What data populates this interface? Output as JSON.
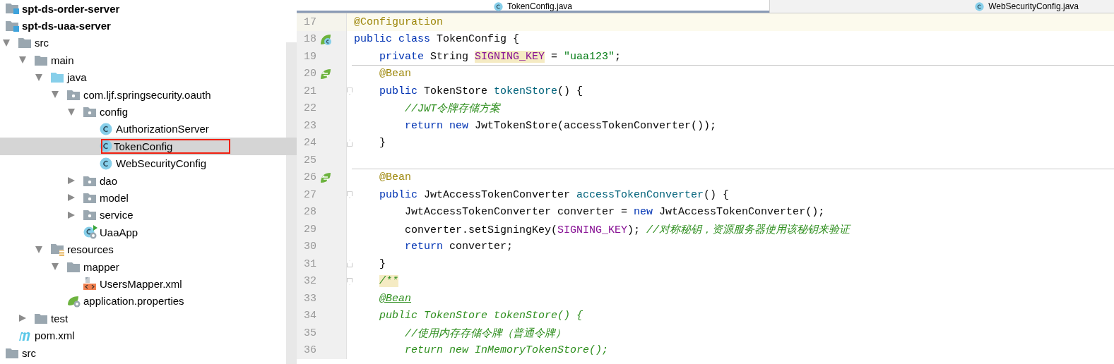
{
  "project_tree": [
    {
      "label": "spt-ds-order-server",
      "kind": "module"
    },
    {
      "label": "spt-ds-uaa-server",
      "kind": "module",
      "children": [
        {
          "label": "src",
          "kind": "folder",
          "expanded": true,
          "children": [
            {
              "label": "main",
              "kind": "folder",
              "expanded": true,
              "children": [
                {
                  "label": "java",
                  "kind": "source-folder",
                  "expanded": true,
                  "children": [
                    {
                      "label": "com.ljf.springsecurity.oauth",
                      "kind": "package",
                      "expanded": true,
                      "children": [
                        {
                          "label": "config",
                          "kind": "package",
                          "expanded": true,
                          "children": [
                            {
                              "label": "AuthorizationServer",
                              "kind": "class",
                              "selected": false,
                              "outlined": false
                            },
                            {
                              "label": "TokenConfig",
                              "kind": "class",
                              "selected": true,
                              "outlined": true
                            },
                            {
                              "label": "WebSecurityConfig",
                              "kind": "class",
                              "selected": false,
                              "outlined": false
                            }
                          ]
                        },
                        {
                          "label": "dao",
                          "kind": "package",
                          "expanded": false
                        },
                        {
                          "label": "model",
                          "kind": "package",
                          "expanded": false
                        },
                        {
                          "label": "service",
                          "kind": "package",
                          "expanded": false
                        },
                        {
                          "label": "UaaApp",
                          "kind": "app-class"
                        }
                      ]
                    }
                  ]
                },
                {
                  "label": "resources",
                  "kind": "resources-folder",
                  "expanded": true,
                  "children": [
                    {
                      "label": "mapper",
                      "kind": "folder",
                      "expanded": true,
                      "children": [
                        {
                          "label": "UsersMapper.xml",
                          "kind": "xml"
                        }
                      ]
                    },
                    {
                      "label": "application.properties",
                      "kind": "properties"
                    }
                  ]
                }
              ]
            },
            {
              "label": "test",
              "kind": "folder",
              "expanded": false
            }
          ]
        },
        {
          "label": "pom.xml",
          "kind": "pom"
        }
      ]
    },
    {
      "label": "src",
      "kind": "folder"
    }
  ],
  "editor": {
    "tabs": [
      {
        "label": "TokenConfig.java",
        "selected": true
      },
      {
        "label": "WebSecurityConfig.java",
        "selected": false
      }
    ],
    "lines": [
      {
        "number": "17",
        "current": true,
        "tokens": [
          {
            "text": "@Configuration",
            "kind": "annotation"
          }
        ]
      },
      {
        "number": "18",
        "class_bean_marker": true,
        "tokens": [
          {
            "text": "public class ",
            "kind": "keyword"
          },
          {
            "text": "TokenConfig {",
            "kind": "plain"
          }
        ]
      },
      {
        "number": "19",
        "separator_after": true,
        "tokens": [
          {
            "text": "    private ",
            "kind": "keyword"
          },
          {
            "text": "String ",
            "kind": "plain"
          },
          {
            "text": "SIGNING_KEY",
            "kind": "field",
            "highlighted": true
          },
          {
            "text": " = ",
            "kind": "plain"
          },
          {
            "text": "\"uaa123\"",
            "kind": "string"
          },
          {
            "text": ";",
            "kind": "plain"
          }
        ]
      },
      {
        "number": "20",
        "bean_marker": true,
        "tokens": [
          {
            "text": "    @Bean",
            "kind": "annotation"
          }
        ]
      },
      {
        "number": "21",
        "fold_start": true,
        "tokens": [
          {
            "text": "    public ",
            "kind": "keyword"
          },
          {
            "text": "TokenStore ",
            "kind": "plain"
          },
          {
            "text": "tokenStore",
            "kind": "method"
          },
          {
            "text": "() {",
            "kind": "plain"
          }
        ]
      },
      {
        "number": "22",
        "tokens": [
          {
            "text": "        //JWT令牌存储方案",
            "kind": "comment"
          }
        ]
      },
      {
        "number": "23",
        "tokens": [
          {
            "text": "        return new ",
            "kind": "keyword"
          },
          {
            "text": "JwtTokenStore(accessTokenConverter());",
            "kind": "plain"
          }
        ]
      },
      {
        "number": "24",
        "fold_end": true,
        "tokens": [
          {
            "text": "    }",
            "kind": "plain"
          }
        ]
      },
      {
        "number": "25",
        "separator_after": true
      },
      {
        "number": "26",
        "bean_marker": true,
        "tokens": [
          {
            "text": "    @Bean",
            "kind": "annotation"
          }
        ]
      },
      {
        "number": "27",
        "fold_start": true,
        "tokens": [
          {
            "text": "    public ",
            "kind": "keyword"
          },
          {
            "text": "JwtAccessTokenConverter ",
            "kind": "plain"
          },
          {
            "text": "accessTokenConverter",
            "kind": "method"
          },
          {
            "text": "() {",
            "kind": "plain"
          }
        ]
      },
      {
        "number": "28",
        "tokens": [
          {
            "text": "        JwtAccessTokenConverter converter = ",
            "kind": "plain"
          },
          {
            "text": "new ",
            "kind": "keyword"
          },
          {
            "text": "JwtAccessTokenConverter();",
            "kind": "plain"
          }
        ]
      },
      {
        "number": "29",
        "tokens": [
          {
            "text": "        converter.setSigningKey(",
            "kind": "plain"
          },
          {
            "text": "SIGNING_KEY",
            "kind": "field"
          },
          {
            "text": "); ",
            "kind": "plain"
          },
          {
            "text": "//对称秘钥，资源服务器使用该秘钥来验证",
            "kind": "comment"
          }
        ]
      },
      {
        "number": "30",
        "tokens": [
          {
            "text": "        return ",
            "kind": "keyword"
          },
          {
            "text": "converter;",
            "kind": "plain"
          }
        ]
      },
      {
        "number": "31",
        "fold_end": true,
        "tokens": [
          {
            "text": "    }",
            "kind": "plain"
          }
        ]
      },
      {
        "number": "32",
        "fold_start": true,
        "tokens": [
          {
            "text": "    /**",
            "kind": "comment",
            "highlighted": true
          }
        ]
      },
      {
        "number": "33",
        "tokens": [
          {
            "text": "    @Bean",
            "kind": "comment",
            "underlined": true
          }
        ]
      },
      {
        "number": "34",
        "tokens": [
          {
            "text": "    public TokenStore tokenStore() {",
            "kind": "comment"
          }
        ]
      },
      {
        "number": "35",
        "tokens": [
          {
            "text": "        //使用内存存储令牌（普通令牌）",
            "kind": "comment"
          }
        ]
      },
      {
        "number": "36",
        "tokens": [
          {
            "text": "        return new InMemoryTokenStore();",
            "kind": "comment"
          }
        ]
      }
    ]
  }
}
